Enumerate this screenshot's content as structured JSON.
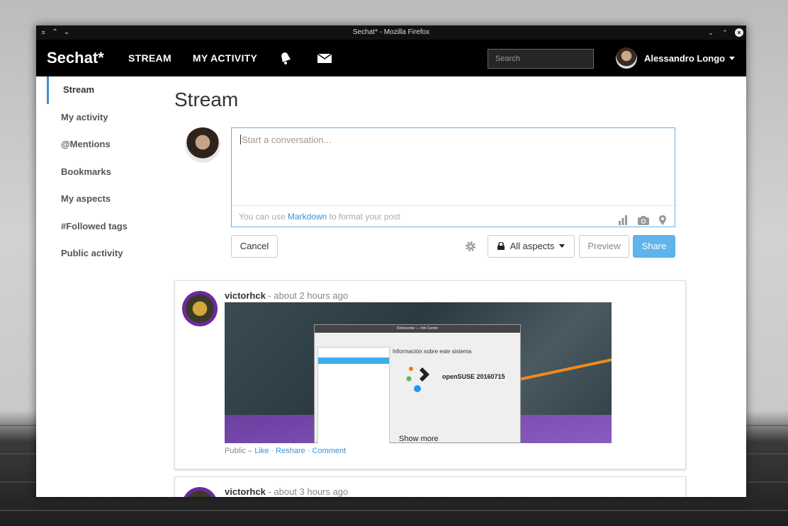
{
  "window": {
    "title": "Sechat* - Mozilla Firefox"
  },
  "navbar": {
    "brand": "Sechat*",
    "links": [
      "STREAM",
      "MY ACTIVITY"
    ],
    "search_placeholder": "Search",
    "user_name": "Alessandro Longo"
  },
  "sidebar": {
    "items": [
      {
        "label": "Stream",
        "active": true
      },
      {
        "label": "My activity"
      },
      {
        "label": "@Mentions"
      },
      {
        "label": "Bookmarks"
      },
      {
        "label": "My aspects"
      },
      {
        "label": "#Followed tags"
      },
      {
        "label": "Public activity"
      }
    ]
  },
  "main": {
    "title": "Stream",
    "composer": {
      "placeholder": "Start a conversation...",
      "hint_prefix": "You can use ",
      "hint_link": "Markdown",
      "hint_suffix": " to format your post"
    },
    "buttons": {
      "cancel": "Cancel",
      "aspects": "All aspects",
      "preview": "Preview",
      "share": "Share"
    },
    "posts": [
      {
        "author": "victorhck",
        "time": "- about 2 hours ago",
        "image": {
          "window_title": "KInfocenter — Info Center",
          "heading": "Información sobre este sistema",
          "os": "openSUSE 20160715",
          "show_more": "Show more"
        },
        "visibility": "Public",
        "actions": [
          "Like",
          "Reshare",
          "Comment"
        ]
      },
      {
        "author": "victorhck",
        "time": "- about 3 hours ago"
      }
    ]
  },
  "colors": {
    "accent": "#3f8fd2",
    "share_button": "#60b4eb",
    "navbar": "#000000"
  }
}
